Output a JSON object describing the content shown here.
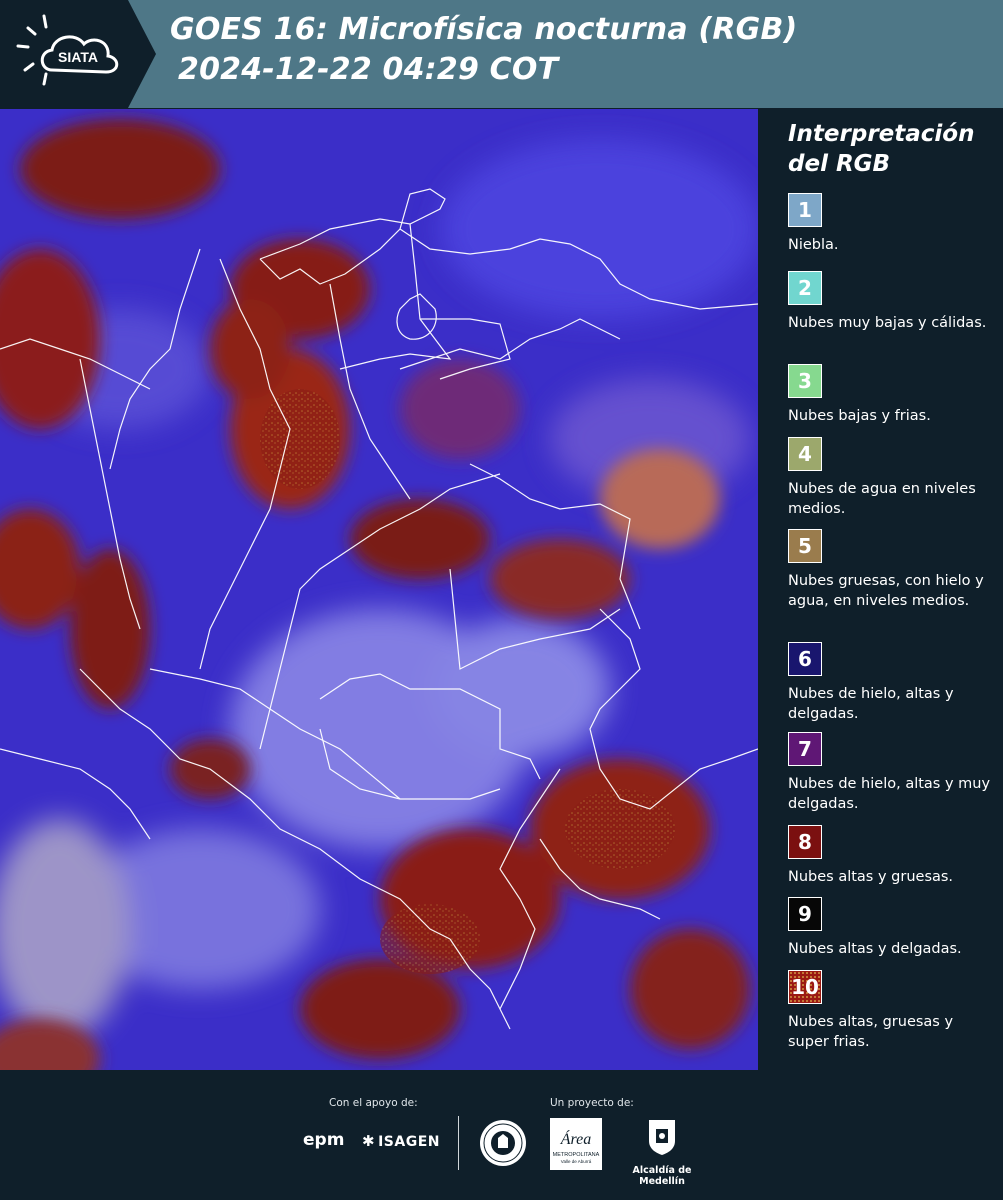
{
  "header": {
    "logo_text": "SIATA",
    "title_line1": "GOES 16: Microfísica nocturna (RGB)",
    "title_line2": "2024-12-22 04:29 COT"
  },
  "legend": {
    "title": "Interpretación del RGB",
    "items": [
      {
        "number": "1",
        "label": "Niebla.",
        "color": "#7ea7c8"
      },
      {
        "number": "2",
        "label": "Nubes muy bajas y cálidas.",
        "color": "#71d6cf"
      },
      {
        "number": "3",
        "label": "Nubes bajas y frias.",
        "color": "#86d98f"
      },
      {
        "number": "4",
        "label": "Nubes de agua en niveles medios.",
        "color": "#9ca86c"
      },
      {
        "number": "5",
        "label": "Nubes gruesas, con hielo y agua, en niveles medios.",
        "color": "#9a7c4d"
      },
      {
        "number": "6",
        "label": "Nubes de hielo, altas y delgadas.",
        "color": "#19166e"
      },
      {
        "number": "7",
        "label": "Nubes de hielo, altas y muy delgadas.",
        "color": "#5f1775"
      },
      {
        "number": "8",
        "label": "Nubes altas y gruesas.",
        "color": "#7b1010"
      },
      {
        "number": "9",
        "label": "Nubes altas y delgadas.",
        "color": "#070707"
      },
      {
        "number": "10",
        "label": "Nubes altas, gruesas y super frias.",
        "color": "#9b1a12"
      }
    ]
  },
  "footer": {
    "support_caption": "Con el apoyo de:",
    "project_caption": "Un proyecto de:",
    "epm_logo": "epm",
    "isagen_logo": "ISAGEN",
    "area_logo_text": "Área",
    "area_logo_subtext": "METROPOLITANA",
    "area_logo_subtext2": "Valle de Aburrá",
    "alcaldia_label": "Alcaldía de Medellín"
  }
}
